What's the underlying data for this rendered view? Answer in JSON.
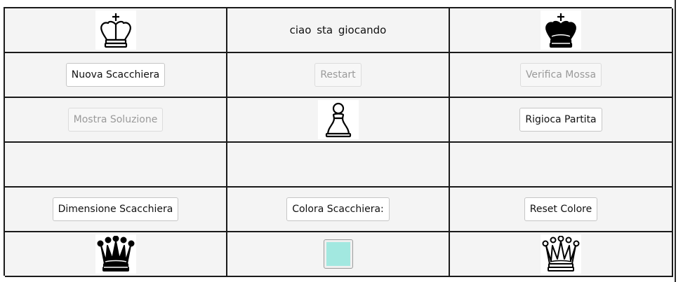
{
  "header": {
    "white_player_icon": "white-king-icon",
    "status_text": "ciao  sta giocando",
    "black_player_icon": "black-king-icon"
  },
  "controls": {
    "new_board": "Nuova Scacchiera",
    "restart": "Restart",
    "verify_move": "Verifica Mossa",
    "show_solution": "Mostra Soluzione",
    "current_piece_icon": "white-pawn-icon",
    "replay_game": "Rigioca Partita"
  },
  "settings": {
    "board_size": "Dimensione Scacchiera",
    "color_board": "Colora Scacchiera:",
    "reset_color": "Reset Colore",
    "selected_color": "#a2e8e0"
  },
  "footer": {
    "left_icon": "black-queen-icon",
    "right_icon": "white-queen-icon"
  }
}
